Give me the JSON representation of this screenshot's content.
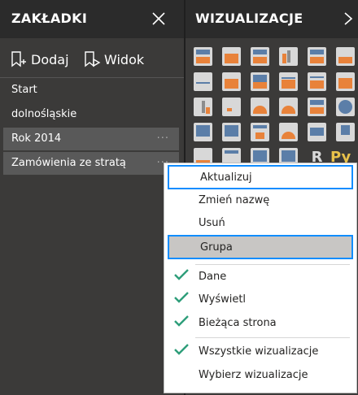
{
  "bookmarks": {
    "title": "ZAKŁADKI",
    "add_label": "Dodaj",
    "view_label": "Widok",
    "items": [
      {
        "label": "Start"
      },
      {
        "label": "dolnośląskie"
      },
      {
        "label": "Rok 2014"
      },
      {
        "label": "Zamówienia ze stratą"
      }
    ],
    "more_label": "···"
  },
  "visualizations": {
    "title": "WIZUALIZACJE",
    "partial_label": "Py"
  },
  "context_menu": {
    "items": [
      {
        "label": "Aktualizuj",
        "checked": false
      },
      {
        "label": "Zmień nazwę",
        "checked": false
      },
      {
        "label": "Usuń",
        "checked": false
      },
      {
        "label": "Grupa",
        "checked": false
      },
      {
        "label": "Dane",
        "checked": true
      },
      {
        "label": "Wyświetl",
        "checked": true
      },
      {
        "label": "Bieżąca strona",
        "checked": true
      },
      {
        "label": "Wszystkie wizualizacje",
        "checked": true
      },
      {
        "label": "Wybierz wizualizacje",
        "checked": false
      }
    ]
  },
  "colors": {
    "header_bg": "#2b2b2b",
    "pane_bg": "#3b3a39",
    "selection_bg": "#595959",
    "focus_blue": "#118dff",
    "highlight_gray": "#c8c6c4",
    "check_green": "#2e9e7a",
    "accent_orange": "#e8823a"
  }
}
